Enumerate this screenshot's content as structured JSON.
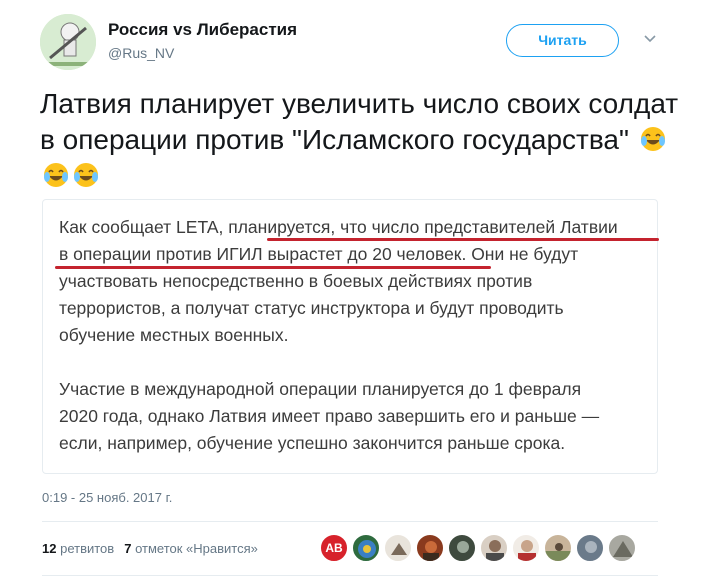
{
  "account": {
    "display_name": "Россия vs Либерастия",
    "handle": "@Rus_NV",
    "follow_label": "Читать"
  },
  "tweet": {
    "text": "Латвия планирует увеличить число своих солдат в операции против \"Исламского государства\"",
    "emojis": [
      "face-with-tears-of-joy",
      "face-with-tears-of-joy",
      "face-with-tears-of-joy"
    ]
  },
  "quote": {
    "p1_l1a": "Как сообщает LETA, ",
    "p1_l1b": "планируется, что число представителей Латвии",
    "p1_l2a": "в операции против ИГИЛ вырастет до 20 человек",
    "p1_l2b": ". Они не будут",
    "p1_l3": "участвовать непосредственно в боевых действиях против",
    "p1_l4": "террористов, а получат статус инструктора и будут проводить",
    "p1_l5": "обучение местных военных.",
    "p2_l1": "Участие в международной операции планируется до 1 февраля",
    "p2_l2": "2020 года, однако Латвия имеет право завершить его и раньше —",
    "p2_l3": "если, например, обучение успешно закончится раньше срока."
  },
  "timestamp": "0:19 - 25 нояб. 2017 г.",
  "stats": {
    "retweets_count": "12",
    "retweets_label": "ретвитов",
    "likes_count": "7",
    "likes_label": "отметок «Нравится»"
  },
  "liker_avatars": [
    "AB",
    "",
    "",
    "",
    "",
    "",
    "",
    "",
    "",
    ""
  ],
  "colors": {
    "accent": "#1da1f2",
    "underline": "#c4232e",
    "secondary_text": "#657786"
  }
}
